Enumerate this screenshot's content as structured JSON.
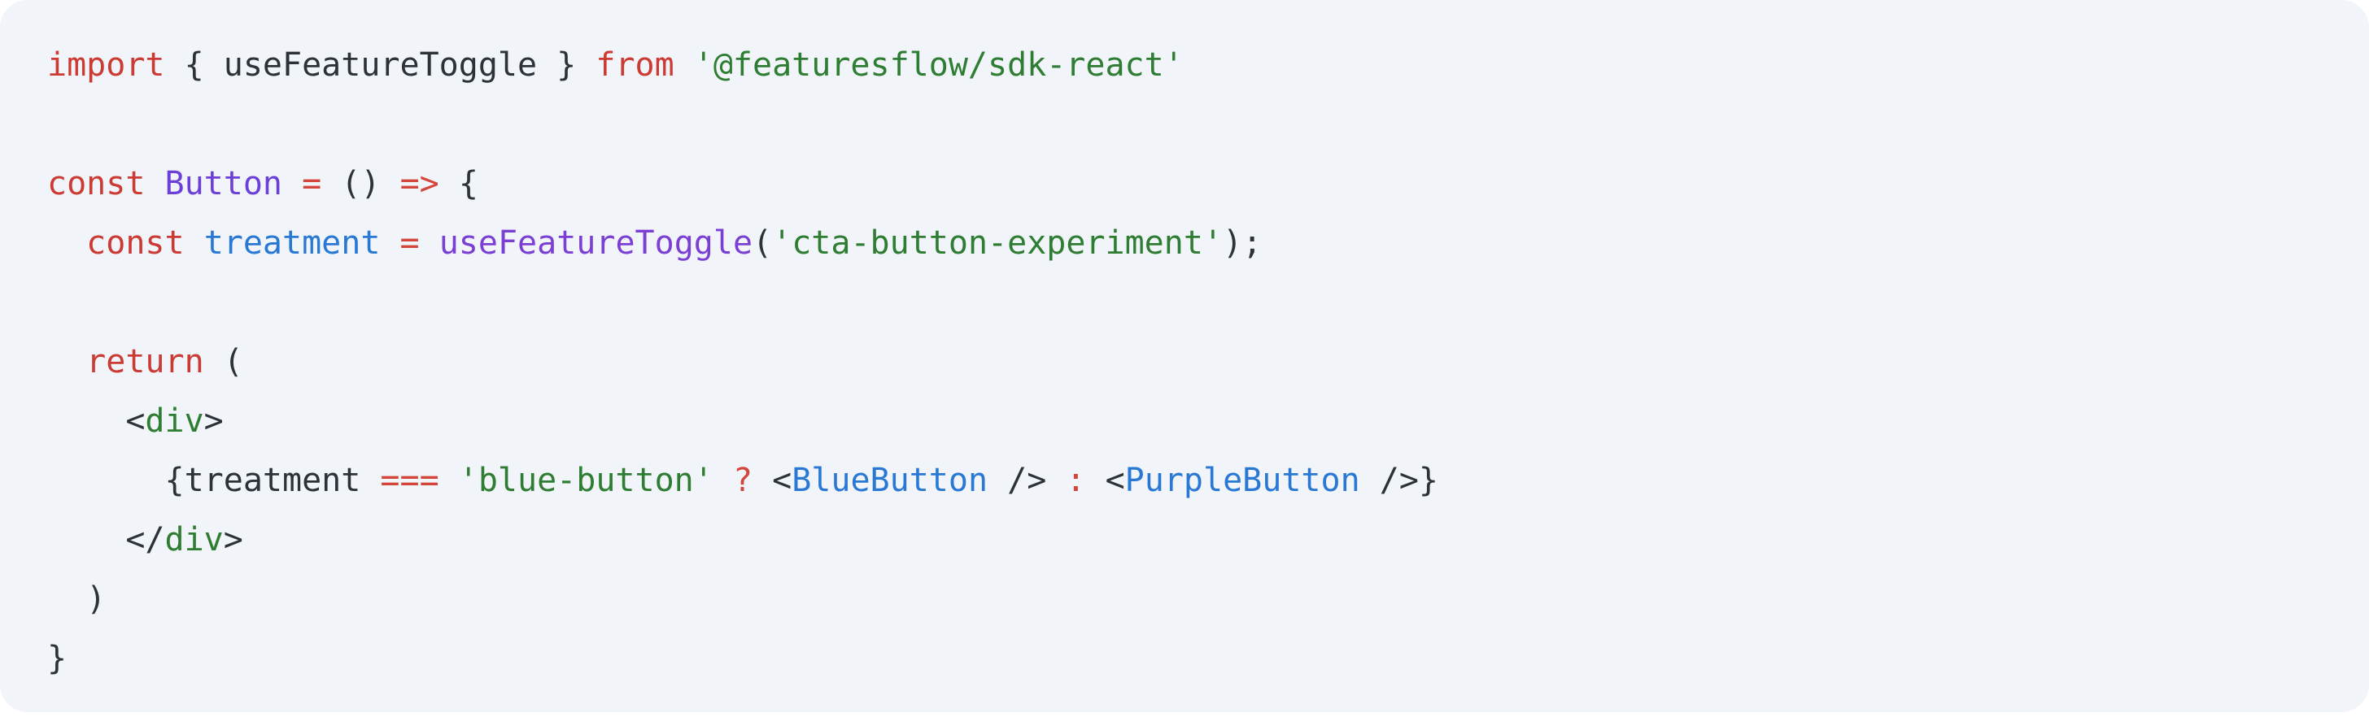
{
  "card": {
    "background_color": "#f1f4f9",
    "page_background_color": "#ffffff",
    "corner_radius": "34px"
  },
  "palette": {
    "keyword": "#cc3b33",
    "operator": "#d4453c",
    "string": "#2e7d32",
    "function": "#7b3fd4",
    "class": "#6c3fd8",
    "variable": "#2878d4",
    "component": "#2878d4",
    "tag": "#2e7d32",
    "punctuation": "#2d3138",
    "plain": "#2d3138"
  },
  "code": {
    "language": "jsx",
    "full_text": "import { useFeatureToggle } from '@featuresflow/sdk-react'\n\nconst Button = () => {\n  const treatment = useFeatureToggle('cta-button-experiment');\n\n  return (\n    <div>\n      {treatment === 'blue-button' ? <BlueButton /> : <PurpleButton />}\n    </div>\n  )\n}",
    "lines": [
      {
        "index": 1,
        "tokens": [
          {
            "t": "import",
            "k": "keyword"
          },
          {
            "t": " ",
            "k": "plain"
          },
          {
            "t": "{ useFeatureToggle }",
            "k": "plain"
          },
          {
            "t": " ",
            "k": "plain"
          },
          {
            "t": "from",
            "k": "keyword"
          },
          {
            "t": " ",
            "k": "plain"
          },
          {
            "t": "'@featuresflow/sdk-react'",
            "k": "string"
          }
        ]
      },
      {
        "index": 2,
        "tokens": []
      },
      {
        "index": 3,
        "tokens": [
          {
            "t": "const",
            "k": "keyword"
          },
          {
            "t": " ",
            "k": "plain"
          },
          {
            "t": "Button",
            "k": "class"
          },
          {
            "t": " ",
            "k": "plain"
          },
          {
            "t": "=",
            "k": "operator"
          },
          {
            "t": " ",
            "k": "plain"
          },
          {
            "t": "()",
            "k": "punctuation"
          },
          {
            "t": " ",
            "k": "plain"
          },
          {
            "t": "=>",
            "k": "operator"
          },
          {
            "t": " ",
            "k": "plain"
          },
          {
            "t": "{",
            "k": "punctuation"
          }
        ]
      },
      {
        "index": 4,
        "tokens": [
          {
            "t": "  ",
            "k": "plain"
          },
          {
            "t": "const",
            "k": "keyword"
          },
          {
            "t": " ",
            "k": "plain"
          },
          {
            "t": "treatment",
            "k": "variable"
          },
          {
            "t": " ",
            "k": "plain"
          },
          {
            "t": "=",
            "k": "operator"
          },
          {
            "t": " ",
            "k": "plain"
          },
          {
            "t": "useFeatureToggle",
            "k": "function"
          },
          {
            "t": "(",
            "k": "punctuation"
          },
          {
            "t": "'cta-button-experiment'",
            "k": "string"
          },
          {
            "t": ");",
            "k": "punctuation"
          }
        ]
      },
      {
        "index": 5,
        "tokens": []
      },
      {
        "index": 6,
        "tokens": [
          {
            "t": "  ",
            "k": "plain"
          },
          {
            "t": "return",
            "k": "keyword"
          },
          {
            "t": " ",
            "k": "plain"
          },
          {
            "t": "(",
            "k": "punctuation"
          }
        ]
      },
      {
        "index": 7,
        "tokens": [
          {
            "t": "    ",
            "k": "plain"
          },
          {
            "t": "<",
            "k": "punctuation"
          },
          {
            "t": "div",
            "k": "tag"
          },
          {
            "t": ">",
            "k": "punctuation"
          }
        ]
      },
      {
        "index": 8,
        "tokens": [
          {
            "t": "      ",
            "k": "plain"
          },
          {
            "t": "{treatment",
            "k": "plain"
          },
          {
            "t": " ",
            "k": "plain"
          },
          {
            "t": "===",
            "k": "operator"
          },
          {
            "t": " ",
            "k": "plain"
          },
          {
            "t": "'blue-button'",
            "k": "string"
          },
          {
            "t": " ",
            "k": "plain"
          },
          {
            "t": "?",
            "k": "operator"
          },
          {
            "t": " ",
            "k": "plain"
          },
          {
            "t": "<",
            "k": "punctuation"
          },
          {
            "t": "BlueButton",
            "k": "component"
          },
          {
            "t": " />",
            "k": "punctuation"
          },
          {
            "t": " ",
            "k": "plain"
          },
          {
            "t": ":",
            "k": "operator"
          },
          {
            "t": " ",
            "k": "plain"
          },
          {
            "t": "<",
            "k": "punctuation"
          },
          {
            "t": "PurpleButton",
            "k": "component"
          },
          {
            "t": " />}",
            "k": "punctuation"
          }
        ]
      },
      {
        "index": 9,
        "tokens": [
          {
            "t": "    ",
            "k": "plain"
          },
          {
            "t": "</",
            "k": "punctuation"
          },
          {
            "t": "div",
            "k": "tag"
          },
          {
            "t": ">",
            "k": "punctuation"
          }
        ]
      },
      {
        "index": 10,
        "tokens": [
          {
            "t": "  ",
            "k": "plain"
          },
          {
            "t": ")",
            "k": "punctuation"
          }
        ]
      },
      {
        "index": 11,
        "tokens": [
          {
            "t": "}",
            "k": "punctuation"
          }
        ]
      }
    ]
  }
}
